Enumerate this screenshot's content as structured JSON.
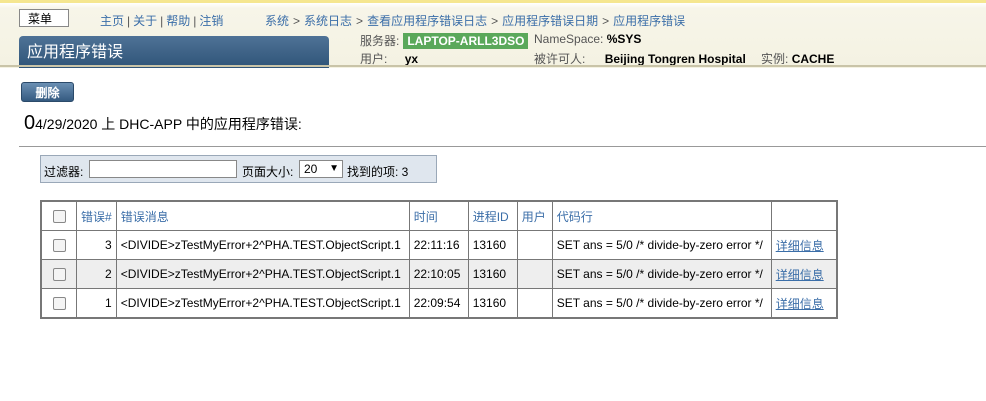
{
  "header": {
    "menu_label": "菜单",
    "links": [
      "主页",
      "关于",
      "帮助",
      "注销"
    ],
    "breadcrumbs": [
      "系统",
      "系统日志",
      "查看应用程序错误日志",
      "应用程序错误日期",
      "应用程序错误"
    ],
    "page_title": "应用程序错误",
    "server_label": "服务器:",
    "server_value": "LAPTOP-ARLL3DSO",
    "namespace_label": "NameSpace:",
    "namespace_value": "%SYS",
    "user_label": "用户:",
    "user_value": "yx",
    "licensee_label": "被许可人:",
    "licensee_value": "Beijing Tongren Hospital",
    "instance_label": "实例:",
    "instance_value": "CACHE",
    "server_badge_color": "#5aa85a"
  },
  "toolbar": {
    "delete_label": "删除"
  },
  "heading": {
    "first_char": "0",
    "rest": "4/29/2020 上 DHC-APP 中的应用程序错误:"
  },
  "filter": {
    "filter_label": "过滤器:",
    "filter_value": "",
    "page_size_label": "页面大小:",
    "page_size_value": "20",
    "found_label": "找到的项: 3"
  },
  "table": {
    "headers": [
      "错误#",
      "错误消息",
      "时间",
      "进程ID",
      "用户",
      "代码行",
      ""
    ],
    "rows": [
      {
        "num": "3",
        "message": "<DIVIDE>zTestMyError+2^PHA.TEST.ObjectScript.1",
        "time": "22:11:16",
        "pid": "13160",
        "user": "",
        "code": "SET ans = 5/0 /* divide-by-zero error */",
        "link": "详细信息"
      },
      {
        "num": "2",
        "message": "<DIVIDE>zTestMyError+2^PHA.TEST.ObjectScript.1",
        "time": "22:10:05",
        "pid": "13160",
        "user": "",
        "code": "SET ans = 5/0 /* divide-by-zero error */",
        "link": "详细信息"
      },
      {
        "num": "1",
        "message": "<DIVIDE>zTestMyError+2^PHA.TEST.ObjectScript.1",
        "time": "22:09:54",
        "pid": "13160",
        "user": "",
        "code": "SET ans = 5/0 /* divide-by-zero error */",
        "link": "详细信息"
      }
    ]
  }
}
